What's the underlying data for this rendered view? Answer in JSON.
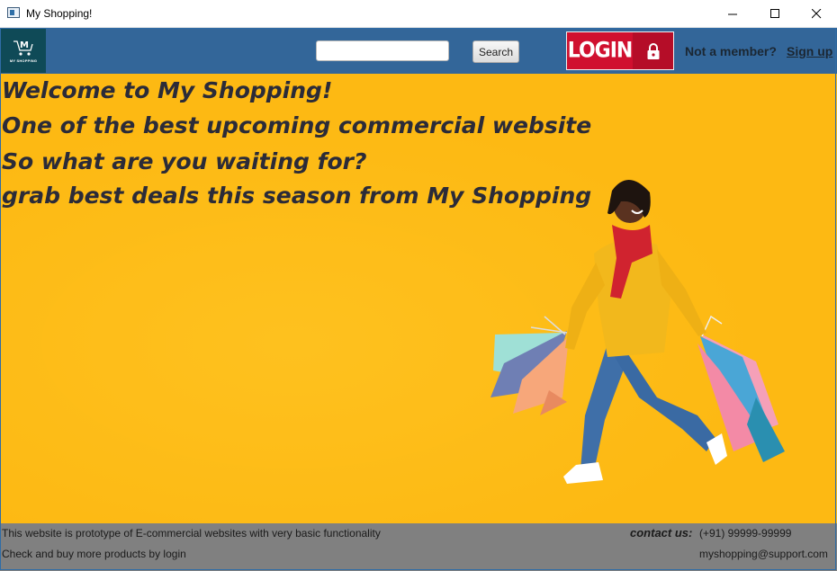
{
  "window": {
    "title": "My Shopping!",
    "controls": [
      "minimize-icon",
      "maximize-icon",
      "close-icon"
    ]
  },
  "header": {
    "logo_text": "MY SHOPPING",
    "search": {
      "value": "",
      "placeholder": ""
    },
    "search_button": "Search",
    "login_button": "LOGIN",
    "login_icon": "lock-icon",
    "not_member": "Not a member?",
    "sign_up": "Sign up",
    "colors": {
      "navbar": "#336699",
      "login": "#d0102f",
      "logo_bg": "#0f4a57"
    }
  },
  "hero": {
    "lines": [
      "Welcome to My Shopping!",
      "One of the best upcoming commercial website",
      "So what are you waiting for?",
      "grab best deals this season from My Shopping"
    ],
    "background": "#fdb913"
  },
  "footer": {
    "note1": "This website is prototype of E-commercial websites with very basic functionality",
    "note2": "Check and buy more products by login",
    "contact_label": "contact us:",
    "phone": "(+91) 99999-99999",
    "email": "myshopping@support.com"
  }
}
